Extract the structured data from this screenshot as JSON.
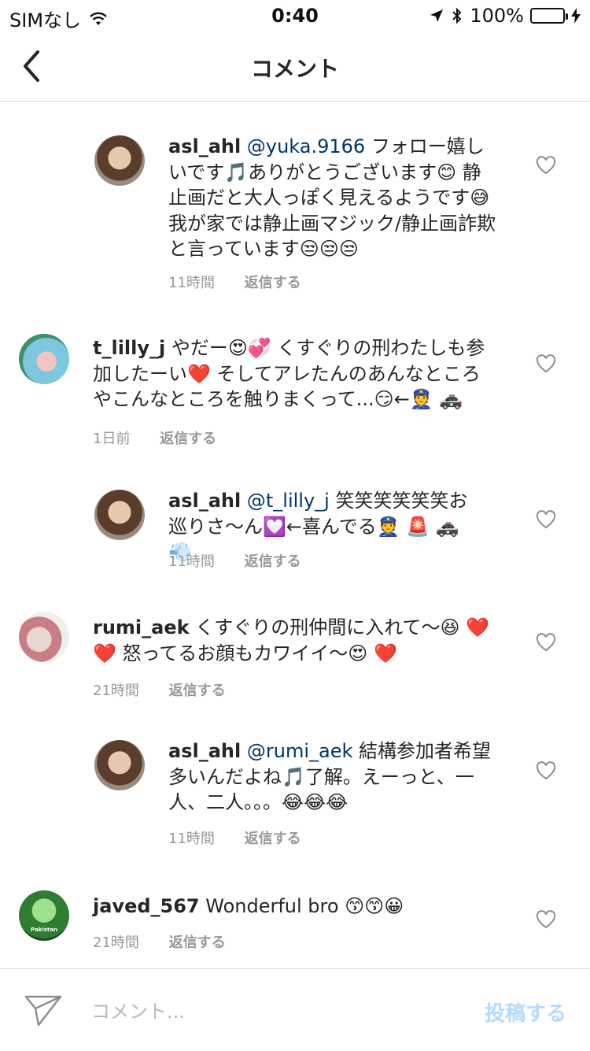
{
  "status_bar": {
    "carrier": "SIMなし",
    "time": "0:40",
    "battery": "100%"
  },
  "header": {
    "title": "コメント"
  },
  "comments": [
    {
      "username": "asl_ahl",
      "mention": "@yuka.9166",
      "text": "フォロー嬉しいです🎵ありがとうございます😊 静止画だと大人っぽく見えるようです😅 我が家では静止画マジック/静止画詐欺と言っています😒😒😒",
      "time": "11時間",
      "reply": "返信する"
    },
    {
      "username": "t_lilly_j",
      "mention": "",
      "text": "やだー😍💞 くすぐりの刑わたしも参加したーい❤️ そしてアレたんのあんなところやこんなところを触りまくって...😏←👮 🚓",
      "time": "1日前",
      "reply": "返信する"
    },
    {
      "username": "asl_ahl",
      "mention": "@t_lilly_j",
      "text": "笑笑笑笑笑笑お巡りさ〜ん💟←喜んでる👮 🚨 🚓 💨",
      "time": "11時間",
      "reply": "返信する"
    },
    {
      "username": "rumi_aek",
      "mention": "",
      "text": "くすぐりの刑仲間に入れて〜😆 ❤️ ❤️ 怒ってるお顔もカワイイ〜😍 ❤️",
      "time": "21時間",
      "reply": "返信する"
    },
    {
      "username": "asl_ahl",
      "mention": "@rumi_aek",
      "text": "結構参加者希望多いんだよね🎵了解。えーっと、一人、二人。。。😂😂😂",
      "time": "11時間",
      "reply": "返信する"
    },
    {
      "username": "javed_567",
      "mention": "",
      "text": "Wonderful bro 😙😙😀",
      "time": "21時間",
      "reply": "返信する",
      "avatar_caption": "Pakistan"
    }
  ],
  "composer": {
    "placeholder": "コメント...",
    "post_label": "投稿する"
  },
  "colors": {
    "mention": "#003569",
    "meta": "#999999",
    "post_button": "#b3dbff",
    "battery": "#4cd964"
  }
}
